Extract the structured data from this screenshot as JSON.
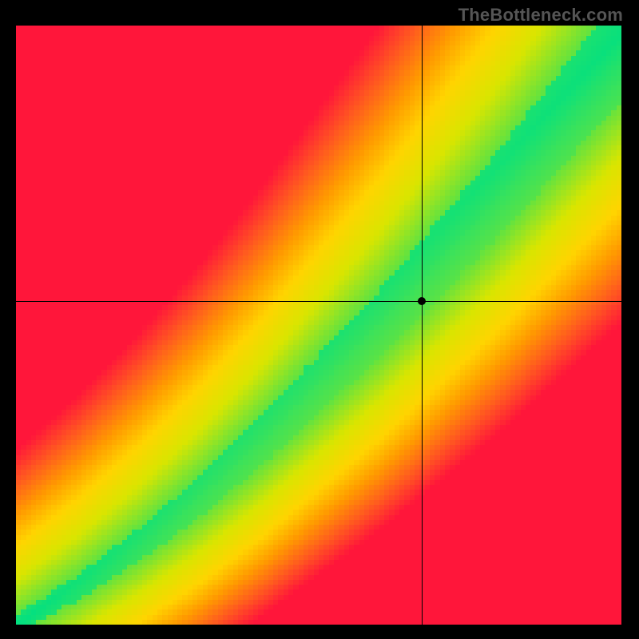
{
  "watermark": "TheBottleneck.com",
  "chart_data": {
    "type": "heatmap",
    "title": "",
    "xlabel": "",
    "ylabel": "",
    "xlim": [
      0,
      100
    ],
    "ylim": [
      0,
      100
    ],
    "crosshair": {
      "x": 67,
      "y": 54
    },
    "marker": {
      "x": 67,
      "y": 54
    },
    "ridge": {
      "description": "Green optimal band along a slightly convex diagonal; color encodes distance from band (green=on band, yellow=near, red=far).",
      "control_points_xy": [
        [
          0,
          0
        ],
        [
          10,
          6
        ],
        [
          20,
          13
        ],
        [
          30,
          21
        ],
        [
          40,
          30
        ],
        [
          50,
          40
        ],
        [
          60,
          50
        ],
        [
          70,
          61
        ],
        [
          80,
          72
        ],
        [
          90,
          84
        ],
        [
          100,
          96
        ]
      ],
      "band_halfwidth_start": 1.5,
      "band_halfwidth_end": 9.0
    },
    "colorscale": [
      {
        "t": 0.0,
        "hex": "#00e082"
      },
      {
        "t": 0.2,
        "hex": "#6be33a"
      },
      {
        "t": 0.38,
        "hex": "#d9e500"
      },
      {
        "t": 0.55,
        "hex": "#ffd400"
      },
      {
        "t": 0.7,
        "hex": "#ff9a00"
      },
      {
        "t": 0.85,
        "hex": "#ff5a1f"
      },
      {
        "t": 1.0,
        "hex": "#ff163a"
      }
    ],
    "grid_resolution": 120
  }
}
